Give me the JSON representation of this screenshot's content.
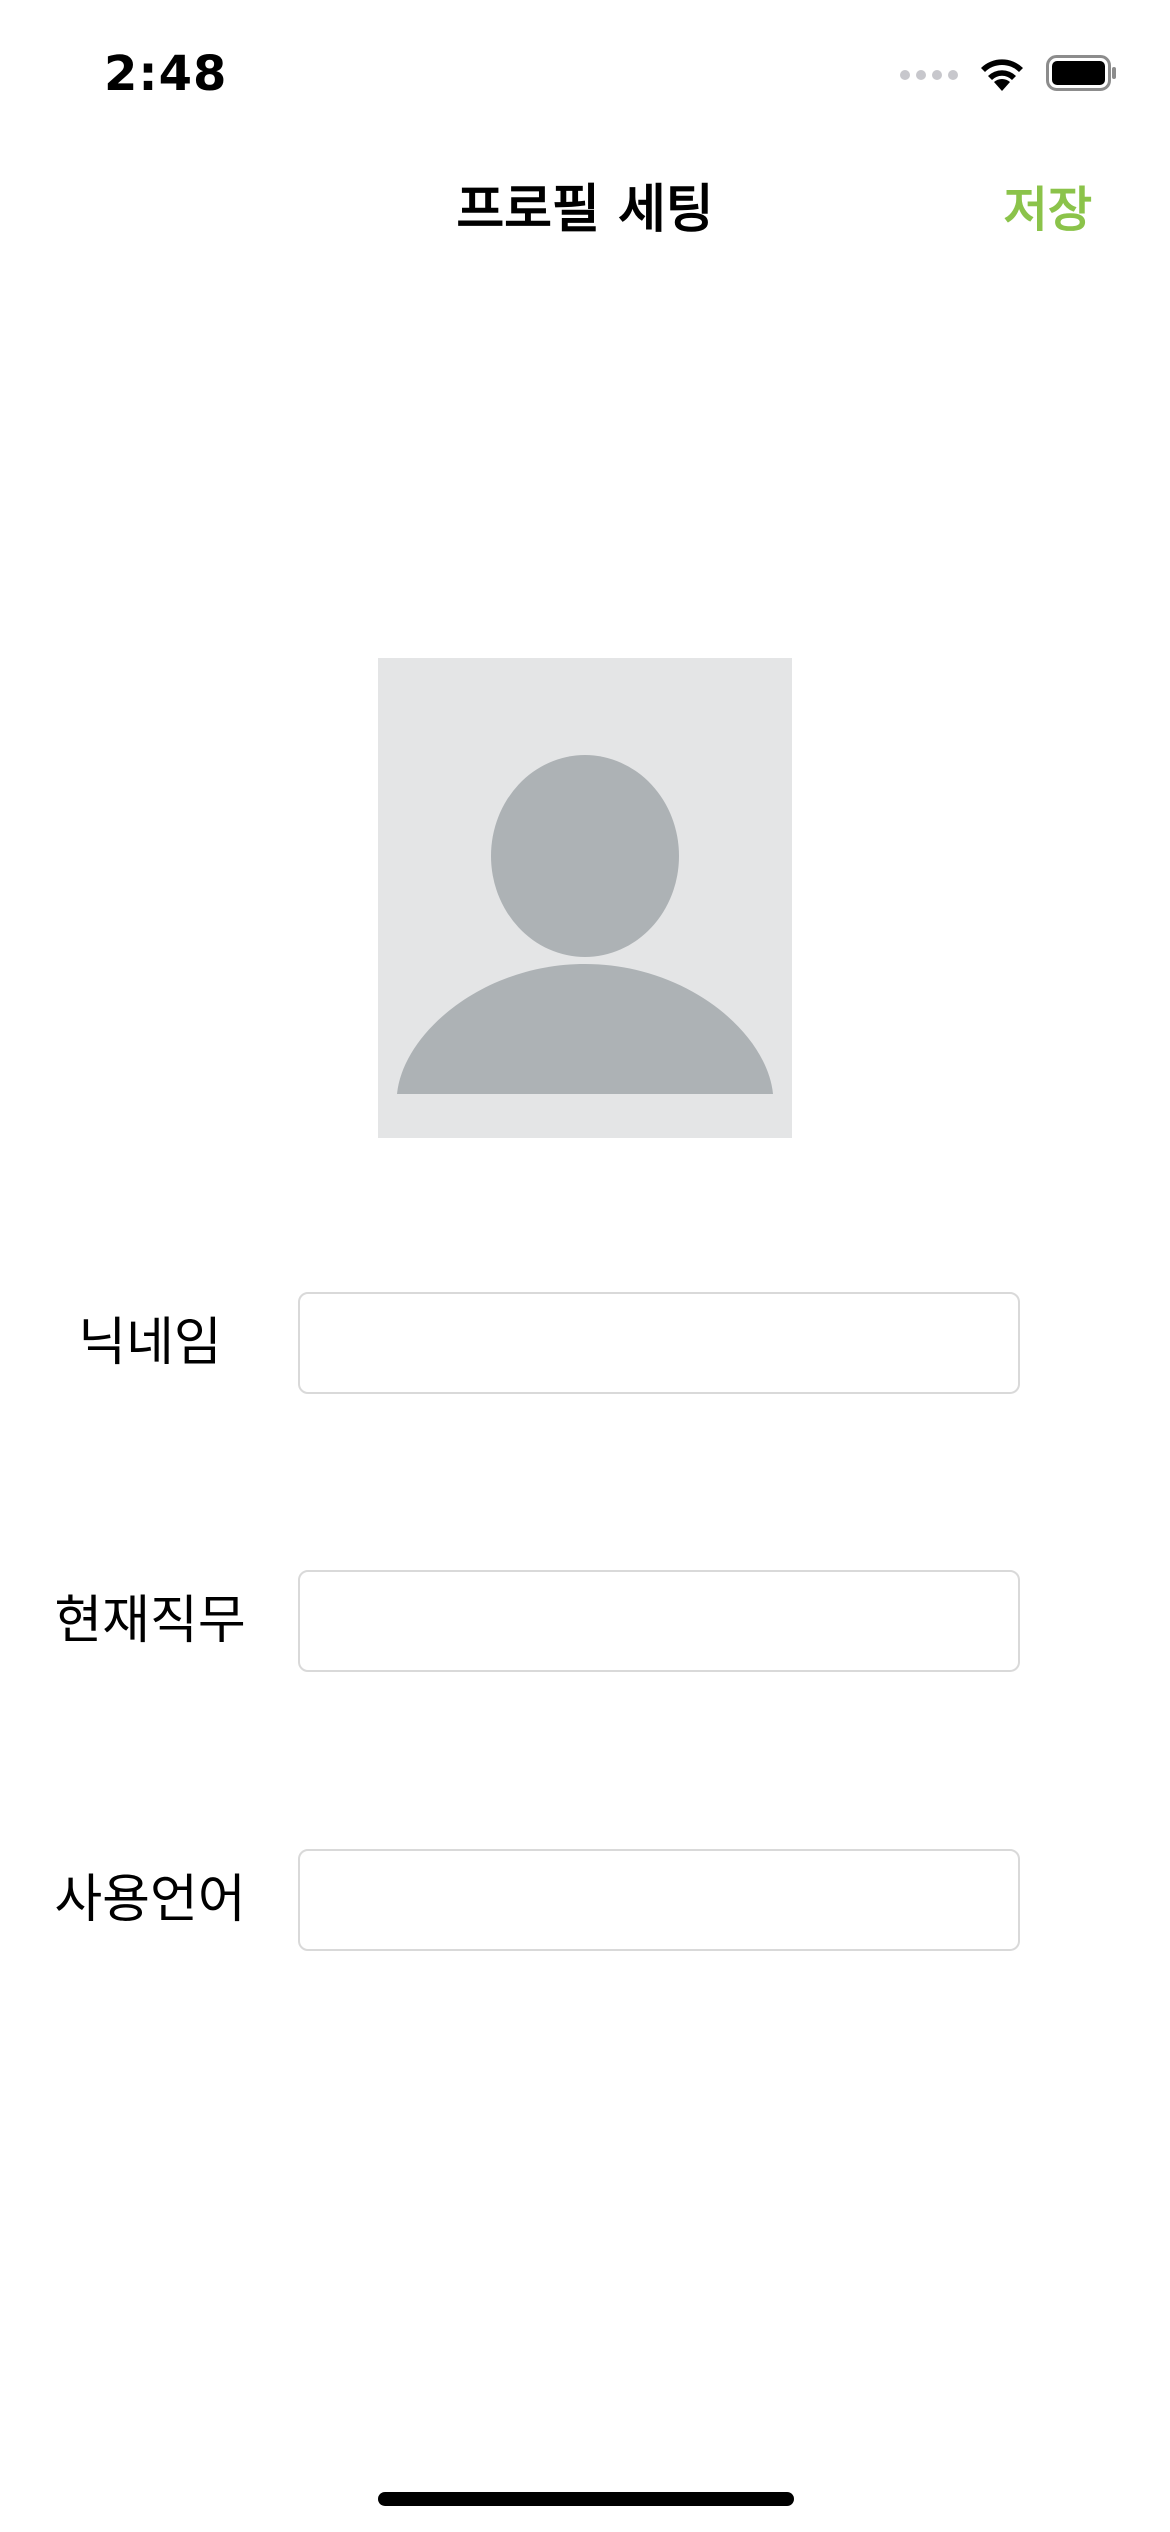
{
  "status_bar": {
    "time": "2:48"
  },
  "nav": {
    "title": "프로필 세팅",
    "save_label": "저장",
    "accent_color": "#8bc34a"
  },
  "profile": {
    "image_icon": "person-placeholder-icon"
  },
  "form": {
    "nickname": {
      "label": "닉네임",
      "value": ""
    },
    "current_job": {
      "label": "현재직무",
      "value": ""
    },
    "language": {
      "label": "사용언어",
      "value": ""
    }
  }
}
